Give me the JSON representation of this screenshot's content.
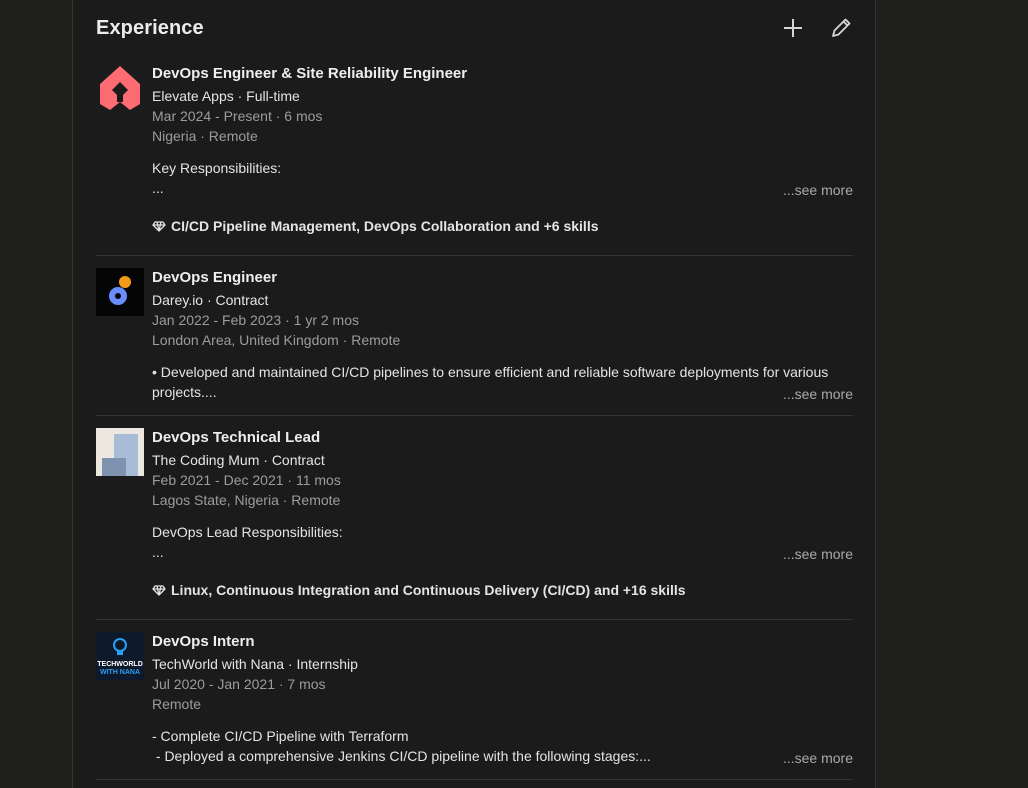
{
  "section": {
    "title": "Experience"
  },
  "icons": {
    "add": "plus-icon",
    "edit": "pencil-icon",
    "skill": "diamond-icon"
  },
  "entries": [
    {
      "role": "DevOps Engineer & Site Reliability Engineer",
      "company": "Elevate Apps · Full-time",
      "dates": "Mar 2024 - Present · 6 mos",
      "location": "Nigeria · Remote",
      "description_lines": [
        "Key Responsibilities:",
        "..."
      ],
      "see_more": "...see more",
      "skills": "CI/CD Pipeline Management, DevOps Collaboration and +6 skills",
      "logo_color": "#ff5a5f"
    },
    {
      "role": "DevOps Engineer",
      "company": "Darey.io · Contract",
      "dates": "Jan 2022 - Feb 2023 · 1 yr 2 mos",
      "location": "London Area, United Kingdom · Remote",
      "description_lines": [
        "• Developed and maintained CI/CD pipelines to ensure efficient and reliable software deployments for various",
        "projects...."
      ],
      "see_more": "...see more",
      "logo_color": "#6b8cff"
    },
    {
      "role": "DevOps Technical Lead",
      "company": "The Coding Mum · Contract",
      "dates": "Feb 2021 - Dec 2021 · 11 mos",
      "location": "Lagos State, Nigeria · Remote",
      "description_lines": [
        "DevOps Lead Responsibilities:",
        "..."
      ],
      "see_more": "...see more",
      "skills": "Linux, Continuous Integration and Continuous Delivery (CI/CD) and +16 skills",
      "logo_color": "#9fb3cf"
    },
    {
      "role": "DevOps Intern",
      "company": "TechWorld with Nana · Internship",
      "dates": "Jul 2020 - Jan 2021 · 7 mos",
      "location": "Remote",
      "description_lines": [
        "- Complete CI/CD Pipeline with Terraform",
        " - Deployed a comprehensive Jenkins CI/CD pipeline with the following stages:..."
      ],
      "see_more": "...see more",
      "logo_text": [
        "TECHWORLD",
        "WITH NANA"
      ],
      "logo_color": "#2a9df4"
    }
  ]
}
